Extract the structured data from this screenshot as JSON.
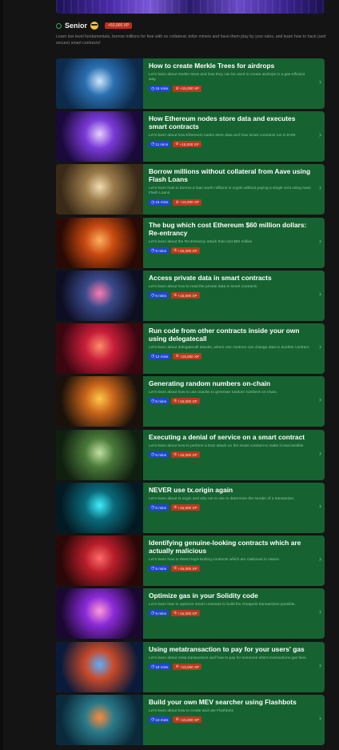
{
  "level": {
    "name": "Senior",
    "emoji_icon": "sunglasses-face-icon",
    "xp_badge": "+50,000 XP"
  },
  "intro": "Learn low level fundamentals, borrow millions for free with no collateral, bribe miners and have them play by your rules, and learn how to hack (and secure) smart contracts!",
  "lessons": [
    {
      "title": "How to create Merkle Trees for airdrops",
      "desc": "Let's learn about merkle trees and how they can be used to create airdrops in a gas-efficient way.",
      "time": "15 mins",
      "xp": "+15,000 XP"
    },
    {
      "title": "How Ethereum nodes store data and executes smart contracts",
      "desc": "Let's learn about how Ethereum nodes store data and how smart contracts run in EVM.",
      "time": "11 mins",
      "xp": "+15,000 XP"
    },
    {
      "title": "Borrow millions without collateral from Aave using Flash Loans",
      "desc": "Let's learn how to borrow a loan worth millions in crypto without paying a single cent using Aave Flash Loans.",
      "time": "16 mins",
      "xp": "+15,000 XP"
    },
    {
      "title": "The bug which cost Ethereum $60 million dollars: Re-entrancy",
      "desc": "Let's learn about the Re-Entrancy attack that cost $60 million",
      "time": "9 mins",
      "xp": "+15,000 XP"
    },
    {
      "title": "Access private data in smart contracts",
      "desc": "Let's learn about how to read the private data in smart contracts",
      "time": "6 mins",
      "xp": "+15,000 XP"
    },
    {
      "title": "Run code from other contracts inside your own using delegatecall",
      "desc": "Let's learn about delegatecall attacks, where one contract can change data in another contract.",
      "time": "12 mins",
      "xp": "+15,000 XP"
    },
    {
      "title": "Generating random numbers on-chain",
      "desc": "Let's learn about how to use oracles to generate random numbers on-chain.",
      "time": "6 mins",
      "xp": "+15,000 XP"
    },
    {
      "title": "Executing a denial of service on a smart contract",
      "desc": "Let's learn about how to perform a DoS attack on the smart contract to make it inaccessible.",
      "time": "6 mins",
      "xp": "+15,000 XP"
    },
    {
      "title": "NEVER use tx.origin again",
      "desc": "Let's learn about tx.origin and why not to use to determine the sender of a transaction.",
      "time": "5 mins",
      "xp": "+15,000 XP"
    },
    {
      "title": "Identifying genuine-looking contracts which are actually malicious",
      "desc": "Let's learn how to detect legit-looking contracts which are malicious in nature.",
      "time": "5 mins",
      "xp": "+15,000 XP"
    },
    {
      "title": "Optimize gas in your Solidity code",
      "desc": "Let's learn how to optimize smart contracts to build the cheapest transactions possible.",
      "time": "9 mins",
      "xp": "+15,000 XP"
    },
    {
      "title": "Using metatransaction to pay for your users' gas",
      "desc": "Let's learn about meta transactions and how to pay for someone else's transactions gas fees.",
      "time": "19 mins",
      "xp": "+15,000 XP"
    },
    {
      "title": "Build your own MEV searcher using Flashbots",
      "desc": "Let's learn about how to create and use Flashbots",
      "time": "10 mins",
      "xp": "+15,000 XP"
    }
  ],
  "icons": {
    "time": "clock-icon",
    "xp": "trophy-icon",
    "chevron": "chevron-right-icon"
  },
  "colors": {
    "card_bg": "#166331",
    "time_badge": "#1f47c8",
    "xp_badge": "#b93a1e",
    "page_bg": "#141414"
  }
}
